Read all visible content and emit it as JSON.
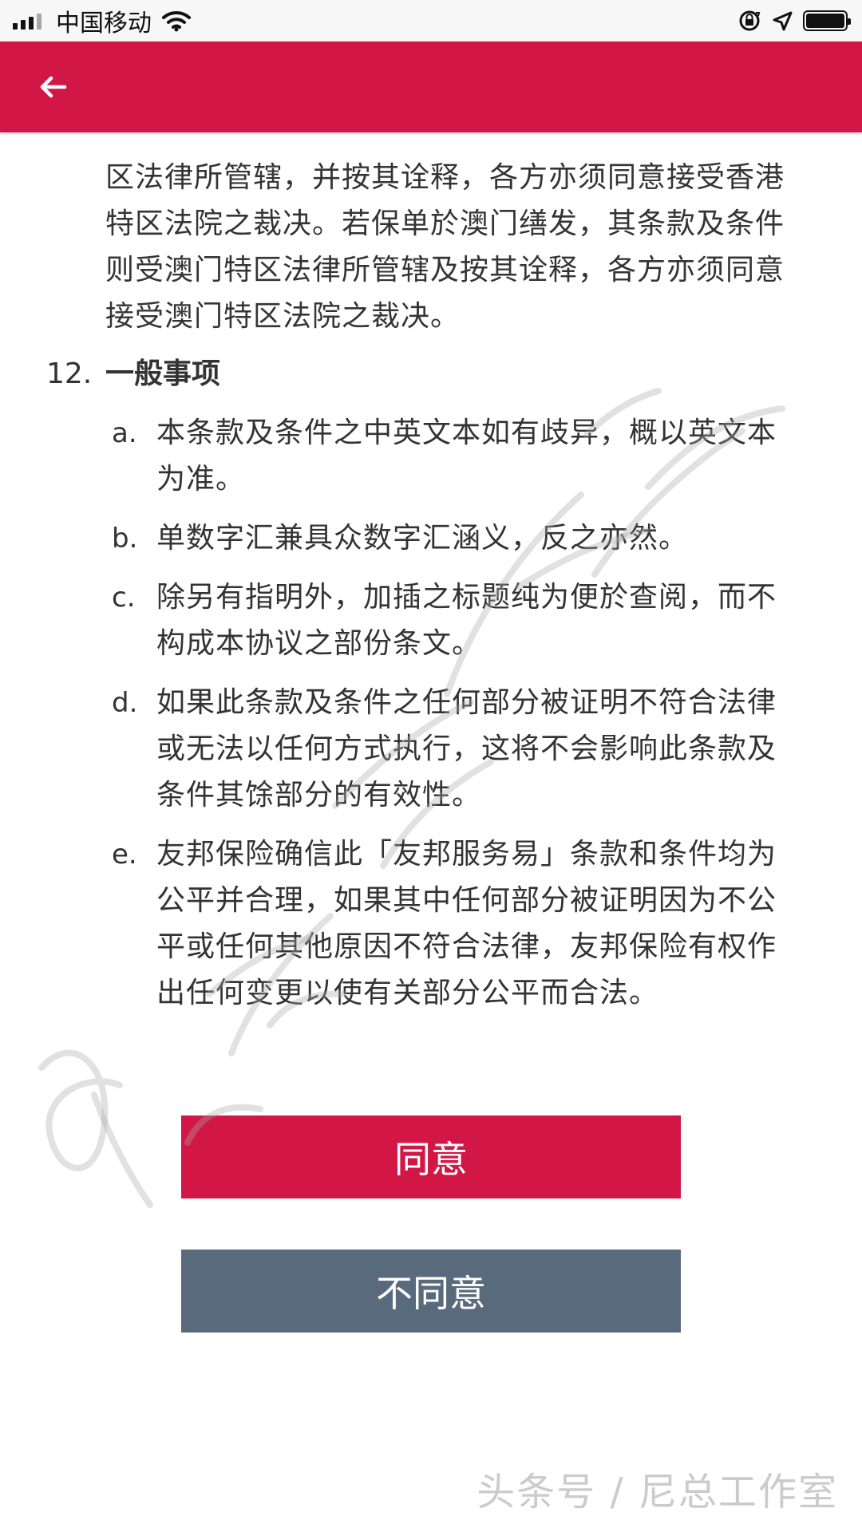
{
  "status_bar": {
    "carrier": "中国移动"
  },
  "header": {
    "back_icon": "arrow-left-icon"
  },
  "content": {
    "continuation_text": "区法律所管辖，并按其诠释，各方亦须同意接受香港特区法院之裁决。若保单於澳门缮发，其条款及条件则受澳门特区法律所管辖及按其诠释，各方亦须同意接受澳门特区法院之裁决。",
    "section": {
      "number": "12.",
      "title": "一般事项",
      "items": [
        {
          "marker": "a.",
          "text": "本条款及条件之中英文本如有歧异，概以英文本为准。"
        },
        {
          "marker": "b.",
          "text": "单数字汇兼具众数字汇涵义，反之亦然。"
        },
        {
          "marker": "c.",
          "text": "除另有指明外，加插之标题纯为便於查阅，而不构成本协议之部份条文。"
        },
        {
          "marker": "d.",
          "text": "如果此条款及条件之任何部分被证明不符合法律或无法以任何方式执行，这将不会影响此条款及条件其馀部分的有效性。"
        },
        {
          "marker": "e.",
          "text": "友邦保险确信此「友邦服务易」条款和条件均为公平并合理，如果其中任何部分被证明因为不公平或任何其他原因不符合法律，友邦保险有权作出任何变更以使有关部分公平而合法。"
        }
      ]
    }
  },
  "actions": {
    "agree_label": "同意",
    "disagree_label": "不同意"
  },
  "watermark": {
    "text": "头条号 / 尼总工作室"
  },
  "colors": {
    "accent": "#d21645",
    "secondary_button": "#5a6a7d"
  }
}
